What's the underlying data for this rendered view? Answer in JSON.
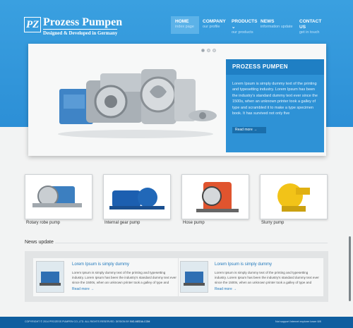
{
  "brand": {
    "monogram": "PZ",
    "name": "Prozess Pumpen",
    "tagline": "Designed & Developed in Germany"
  },
  "nav": [
    {
      "title": "HOME",
      "subtitle": "index page"
    },
    {
      "title": "COMPANY",
      "subtitle": "our profile"
    },
    {
      "title": "PRODUCTS",
      "subtitle": "our products"
    },
    {
      "title": "NEWS",
      "subtitle": "information update"
    },
    {
      "title": "CONTACT US",
      "subtitle": "get in touch"
    }
  ],
  "banner": {
    "heading": "PROZESS PUMPEN",
    "text": "Lorem Ipsum is simply dummy text of the printing and typesetting industry. Lorem Ipsum has been the industry's standard dummy text ever since the 1500s, when an unknown printer took a galley of type and scrambled it to make a type specimen book. It has survived not only five",
    "more": "Read more →"
  },
  "products": [
    "Rotary robe pump",
    "Internal gear pump",
    "Hose pump",
    "Slurry pump"
  ],
  "news": {
    "title": "News update",
    "items": [
      {
        "heading": "Lorem Ipsum is simply dummy",
        "text": "Lorem Ipsum is simply dummy text of the printing and typesetting industry. Lorem Ipsum has been the industry's standard dummy text ever since the 1500s, when an unknown printer took a galley of type and",
        "more": "Read more →"
      },
      {
        "heading": "Lorem Ipsum is simply dummy",
        "text": "Lorem Ipsum is simply dummy text of the printing and typesetting industry. Lorem Ipsum has been the industry's standard dummy text ever since the 1500s, when an unknown printer took a galley of type and",
        "more": "Read more →"
      }
    ]
  },
  "footer": {
    "copyright": "COPYRIGHT © 2014 PROZESS PUMPEN CO.,LTD. ALL RIGHTS RESERVED. DESIGN BY",
    "designer": "BIG-MEDIA.COM",
    "notice": "Not support Internet explorer lower 8/8"
  },
  "colors": {
    "header": "#3aa0e0",
    "panel": "#2e92d6",
    "accent": "#1f7fc4",
    "footer": "#0f5e9f"
  }
}
